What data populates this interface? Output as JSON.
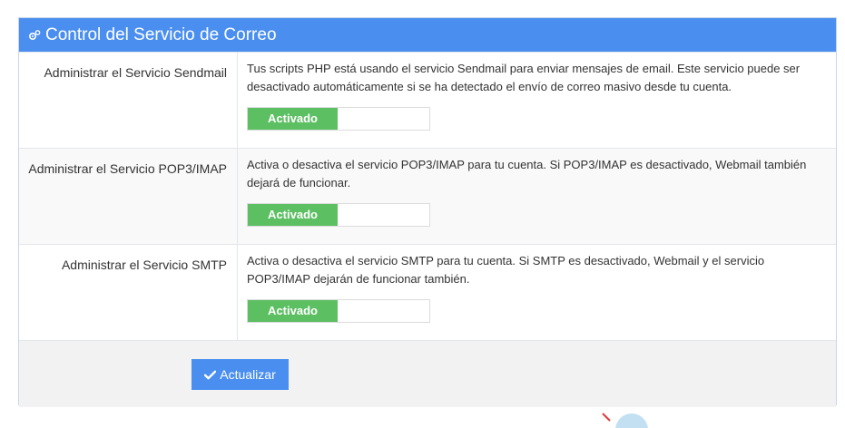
{
  "panel": {
    "title": "Control del Servicio de Correo",
    "header_icon": "gears-icon",
    "accent_color": "#4a8ff0"
  },
  "rows": [
    {
      "label": "Administrar el Servicio Sendmail",
      "description": "Tus scripts PHP está usando el servicio Sendmail para enviar mensajes de email. Este servicio puede ser desactivado automáticamente si se ha detectado el envío de correo masivo desde tu cuenta.",
      "toggle_label": "Activado"
    },
    {
      "label": "Administrar el Servicio POP3/IMAP",
      "description": "Activa o desactiva el servicio POP3/IMAP para tu cuenta. Si POP3/IMAP es desactivado, Webmail también dejará de funcionar.",
      "toggle_label": "Activado"
    },
    {
      "label": "Administrar el Servicio SMTP",
      "description": "Activa o desactiva el servicio SMTP para tu cuenta. Si SMTP es desactivado, Webmail y el servicio POP3/IMAP dejarán de funcionar también.",
      "toggle_label": "Activado"
    }
  ],
  "footer": {
    "update_label": "Actualizar",
    "update_icon": "check-icon"
  },
  "colors": {
    "toggle_on": "#5cbf62",
    "header": "#4a8ff0"
  }
}
